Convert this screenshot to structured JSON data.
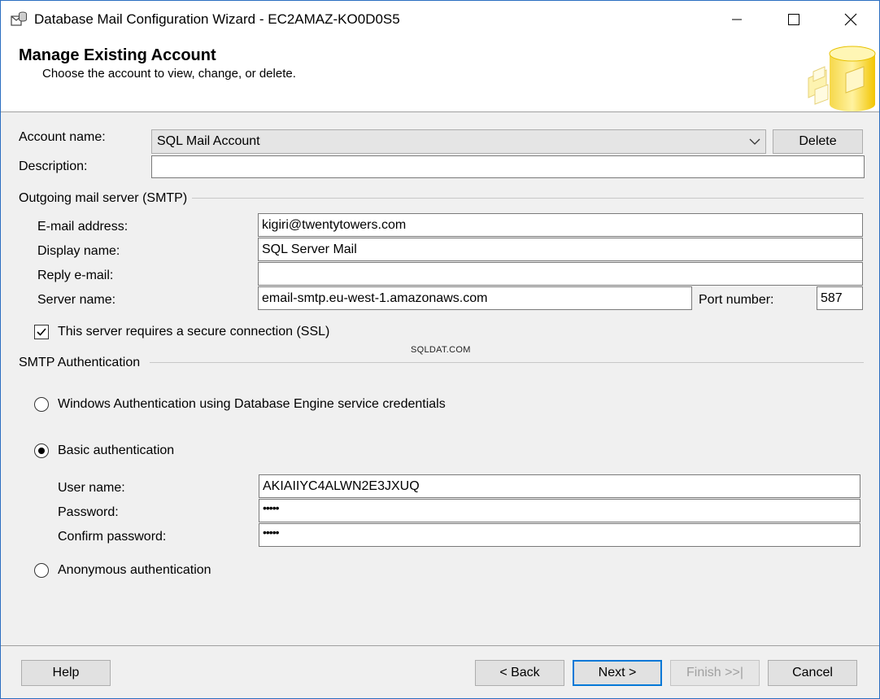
{
  "window": {
    "title": "Database Mail Configuration Wizard - EC2AMAZ-KO0D0S5"
  },
  "header": {
    "title": "Manage Existing Account",
    "subtitle": "Choose the account to view, change, or delete."
  },
  "account": {
    "account_name_label": "Account name:",
    "account_name_value": "SQL Mail Account",
    "delete_label": "Delete",
    "description_label": "Description:",
    "description_value": ""
  },
  "smtp": {
    "group_label": "Outgoing mail server (SMTP)",
    "email_label": "E-mail address:",
    "email_value": "kigiri@twentytowers.com",
    "display_label": "Display name:",
    "display_value": "SQL Server Mail",
    "reply_label": "Reply e-mail:",
    "reply_value": "",
    "server_label": "Server name:",
    "server_value": "email-smtp.eu-west-1.amazonaws.com",
    "port_label": "Port number:",
    "port_value": "587",
    "ssl_label": "This server requires a secure connection (SSL)",
    "ssl_checked": true
  },
  "watermark": "SQLDAT.COM",
  "auth": {
    "group_label": "SMTP Authentication",
    "windows_label": "Windows Authentication using Database Engine service credentials",
    "basic_label": "Basic authentication",
    "selected": "basic",
    "username_label": "User name:",
    "username_value": "AKIAIIYC4ALWN2E3JXUQ",
    "password_label": "Password:",
    "password_value": "•••••",
    "confirm_label": "Confirm password:",
    "confirm_value": "•••••",
    "anonymous_label": "Anonymous authentication"
  },
  "footer": {
    "help_label": "Help",
    "back_label": "< Back",
    "next_label": "Next >",
    "finish_label": "Finish >>|",
    "cancel_label": "Cancel"
  },
  "colors": {
    "accent": "#0078d7",
    "window_border": "#2b6ec1",
    "dialog_bg": "#f0f0f0"
  }
}
